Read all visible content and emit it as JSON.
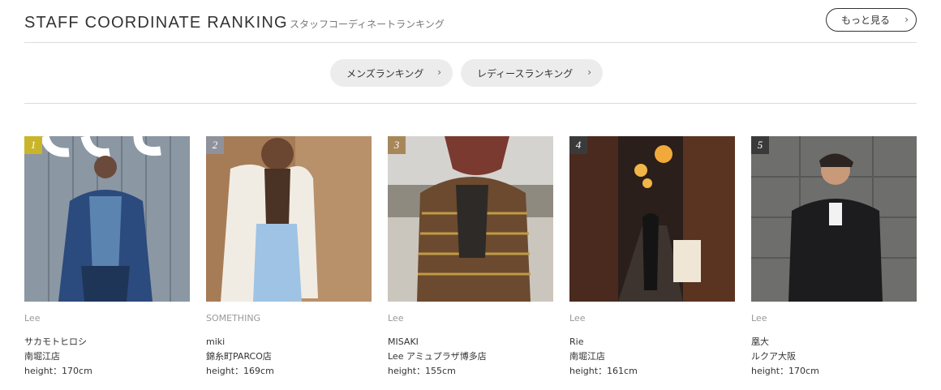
{
  "header": {
    "title": "STAFF COORDINATE RANKING",
    "subtitle": "スタッフコーディネートランキング",
    "more_label": "もっと見る",
    "more_icon": "chevron-right-icon"
  },
  "tabs": [
    {
      "label": "メンズランキング",
      "icon": "chevron-right-icon"
    },
    {
      "label": "レディースランキング",
      "icon": "chevron-right-icon"
    }
  ],
  "cards": [
    {
      "rank": "1",
      "rank_color": "#c9b52a",
      "brand": "Lee",
      "name": "サカモトヒロシ",
      "shop": "南堀江店",
      "height": "height：170cm"
    },
    {
      "rank": "2",
      "rank_color": "#8f929c",
      "brand": "SOMETHING",
      "name": "miki",
      "shop": "錦糸町PARCO店",
      "height": "height：169cm"
    },
    {
      "rank": "3",
      "rank_color": "#a7875a",
      "brand": "Lee",
      "name": "MISAKI",
      "shop": "Lee アミュプラザ博多店",
      "height": "height：155cm"
    },
    {
      "rank": "4",
      "rank_color": "#3a3a3a",
      "brand": "Lee",
      "name": "Rie",
      "shop": "南堀江店",
      "height": "height：161cm"
    },
    {
      "rank": "5",
      "rank_color": "#3a3a3a",
      "brand": "Lee",
      "name": "凰大",
      "shop": "ルクア大阪",
      "height": "height：170cm"
    }
  ]
}
